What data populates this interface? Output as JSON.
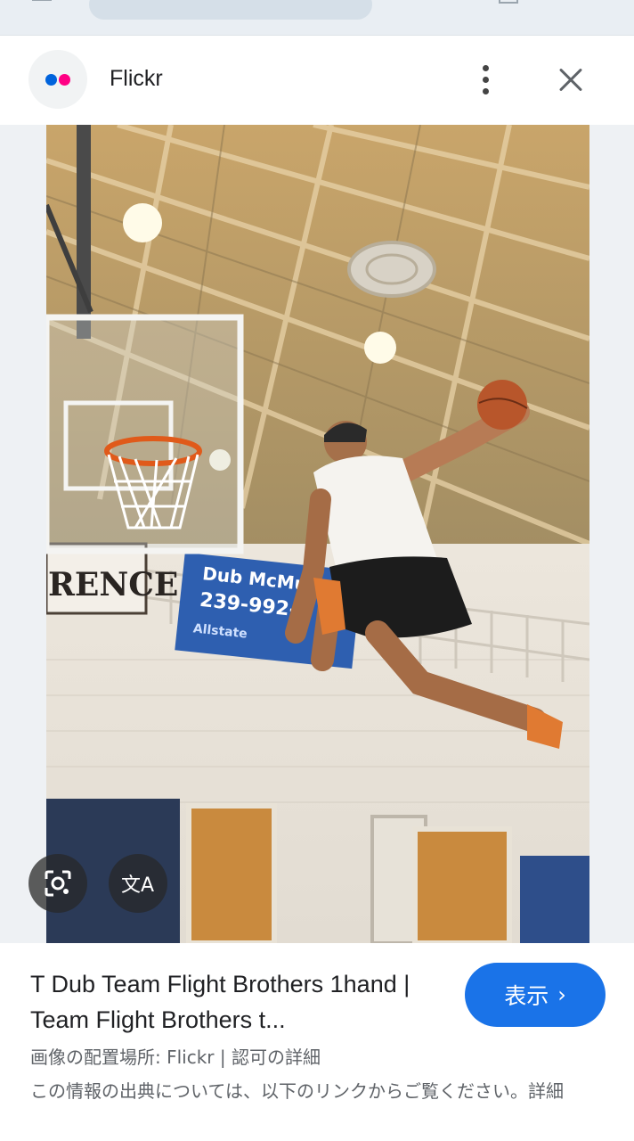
{
  "header": {
    "site_name": "Flickr",
    "logo_colors": {
      "blue": "#0063dc",
      "pink": "#ff0084"
    }
  },
  "preview": {
    "icons": [
      "google-lens-icon",
      "translate-icon"
    ],
    "translate_label": "文A"
  },
  "info": {
    "title": "T Dub Team Flight Brothers 1hand | Team Flight Brothers t...",
    "visit_label": "表示",
    "visit_chevron": "›",
    "source_line": "画像の配置場所: Flickr | 認可の詳細",
    "notice": "この情報の出典については、以下のリンクからご覧ください。詳細"
  },
  "photo_text": {
    "sign_left": "RENCE",
    "banner_line1": "Dub McMul",
    "banner_line2": "239-992-0",
    "banner_logo": "Allstate"
  },
  "colors": {
    "accent": "#1a73e8",
    "text_primary": "#202124",
    "text_secondary": "#5f6368"
  }
}
